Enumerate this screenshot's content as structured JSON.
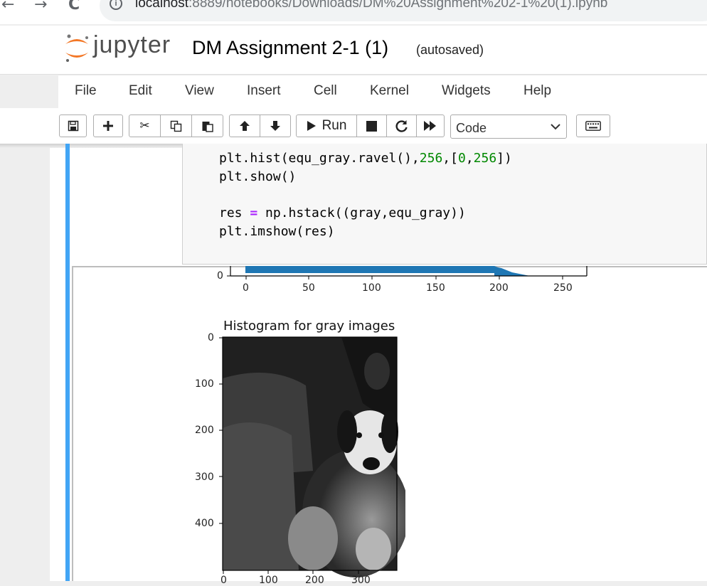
{
  "browser": {
    "back_glyph": "←",
    "forward_glyph": "→",
    "reload_glyph": "C",
    "url_host": "localhost",
    "url_path": ":8889/notebooks/Downloads/DM%20Assignment%202-1%20(1).ipynb"
  },
  "header": {
    "logo_text": "jupyter",
    "notebook_title": "DM Assignment 2-1 (1)",
    "save_status": "(autosaved)"
  },
  "menu": [
    "File",
    "Edit",
    "View",
    "Insert",
    "Cell",
    "Kernel",
    "Widgets",
    "Help"
  ],
  "toolbar": {
    "run_label": "Run",
    "cell_type": "Code"
  },
  "code_lines": {
    "l1_pre": "plt.hist(equ_gray.ravel(),",
    "l1_n1": "256",
    "l1_mid": ",[",
    "l1_n2": "0",
    "l1_comma": ",",
    "l1_n3": "256",
    "l1_end": "])",
    "l2": "plt.show()",
    "l4_pre": "res ",
    "l4_op": "=",
    "l4_post": " np.hstack((gray,equ_gray))",
    "l5": "plt.imshow(res)"
  },
  "output": {
    "histogram_xticks": [
      "0",
      "50",
      "100",
      "150",
      "200",
      "250"
    ],
    "histogram_ytick_visible": "0",
    "image_title": "Histogram for gray images",
    "image_yticks": [
      "0",
      "100",
      "200",
      "300",
      "400"
    ],
    "image_xticks": [
      "0",
      "100",
      "200",
      "300"
    ]
  },
  "colors": {
    "accent": "#42a5f5",
    "hist_bar": "#1f77b4",
    "jupyter_orange": "#f37726"
  }
}
